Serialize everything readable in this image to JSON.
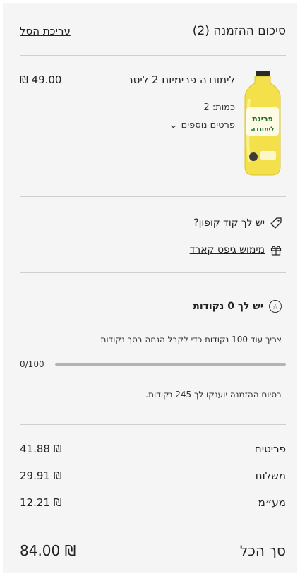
{
  "header": {
    "title": "סיכום ההזמנה (2)",
    "edit_cart": "עריכת הסל"
  },
  "product": {
    "name": "לימונדה פרימיום 2 ליטר",
    "price": "₪ 49.00",
    "quantity": "כמות: 2",
    "more_items": "פרטים נוספים",
    "image_text": "פריגת לימונדה"
  },
  "links": {
    "coupon": "יש לך קוד קופון?",
    "gift_card": "מימוש גיפט קארד"
  },
  "points": {
    "title": "יש לך 0 נקודות",
    "need_more": "צריך עוד 100 נקודות כדי לקבל הנחה בסך נקודות",
    "progress_label": "0/100",
    "progress_fraction": 0,
    "earn": "בסיום ההזמנה יוענקו לך 245 נקודות."
  },
  "totals": {
    "items_label": "פריטים",
    "items_value": "41.88 ₪",
    "shipping_label": "משלוח",
    "shipping_value": "29.91 ₪",
    "vat_label": "מע״מ",
    "vat_value": "12.21 ₪",
    "total_label": "סך הכל",
    "total_value": "84.00 ₪"
  },
  "colors": {
    "background": "#f5f5f5",
    "text": "#222222",
    "divider": "#cfcfcf",
    "bottle_yellow": "#f3e04a"
  },
  "icons": {
    "coupon": "tag-icon",
    "gift": "gift-icon",
    "points": "star-circle-icon",
    "chevron": "chevron-down-icon"
  }
}
